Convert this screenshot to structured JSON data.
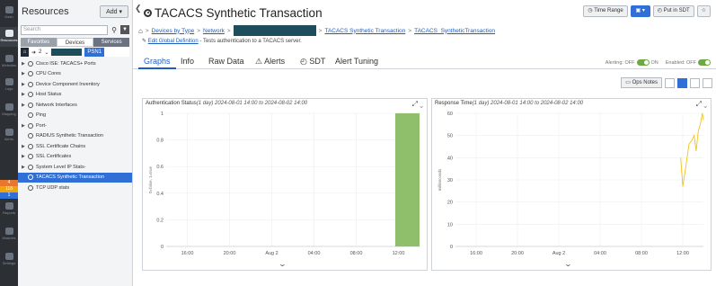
{
  "rail": {
    "items": [
      {
        "label": "Dash",
        "icon": "dashboard-icon"
      },
      {
        "label": "Resources",
        "icon": "resources-icon"
      },
      {
        "label": "Websites",
        "icon": "websites-icon"
      },
      {
        "label": "Logs",
        "icon": "logs-icon"
      },
      {
        "label": "Mapping",
        "icon": "mapping-icon"
      },
      {
        "label": "Alerts",
        "icon": "alerts-icon"
      },
      {
        "label": "Reports",
        "icon": "reports-icon"
      },
      {
        "label": "Modules",
        "icon": "modules-icon"
      },
      {
        "label": "Settings",
        "icon": "settings-icon"
      }
    ],
    "alert_counts": [
      {
        "value": "4",
        "color": "#e8762c"
      },
      {
        "value": "118",
        "color": "#f0a30a"
      },
      {
        "value": "1",
        "color": "#2f6fd6"
      }
    ]
  },
  "resources": {
    "title": "Resources",
    "add_label": "Add",
    "search_placeholder": "Search",
    "tabs": [
      "Favorites",
      "Devices",
      "Services"
    ],
    "path_count": "2",
    "path_suffix": "PSN1",
    "tree": [
      {
        "label": "Cisco ISE: TACACS+ Ports",
        "expand": true
      },
      {
        "label": "CPU Cores",
        "expand": true
      },
      {
        "label": "Device Component Inventory",
        "expand": true
      },
      {
        "label": "Host Status",
        "expand": true
      },
      {
        "label": "Network Interfaces",
        "expand": true
      },
      {
        "label": "Ping",
        "expand": false
      },
      {
        "label": "Port-",
        "expand": true
      },
      {
        "label": "RADIUS Synthetic Transaction",
        "expand": false
      },
      {
        "label": "SSL Certificate Chains",
        "expand": true
      },
      {
        "label": "SSL Certificates",
        "expand": true
      },
      {
        "label": "System Level IP Stats-",
        "expand": true
      },
      {
        "label": "TACACS Synthetic Transaction",
        "expand": false,
        "selected": true
      },
      {
        "label": "TCP UDP stats",
        "expand": false
      }
    ]
  },
  "header": {
    "title": "TACACS Synthetic Transaction",
    "time_range_label": "Time Range",
    "put_in_sdt_label": "Put in SDT",
    "star": "☆"
  },
  "breadcrumb": {
    "items": [
      "Devices by Type",
      "Network",
      "TACACS Synthetic Transaction",
      "TACACS_SyntheticTransaction"
    ]
  },
  "description": {
    "link": "Edit Global Definition",
    "text": " - Tests authentication to a TACACS server."
  },
  "tabs": [
    "Graphs",
    "Info",
    "Raw Data",
    "Alerts",
    "SDT",
    "Alert Tuning"
  ],
  "toggles": {
    "alerting_label": "Alerting:",
    "alerting_off": "OFF",
    "alerting_on": "ON",
    "enabled_label": "Enabled:",
    "enabled_off": "OFF"
  },
  "ops_notes_label": "Ops Notes",
  "chart_data": [
    {
      "type": "area",
      "title": "Authentication Status",
      "subtitle": "(1 day) 2024-08-01 14:00 to 2024-08-02 14:00",
      "ylabel": "0=false, 1=true",
      "ylim": [
        0,
        1
      ],
      "yticks": [
        "1",
        "0.8",
        "0.6",
        "0.4",
        "0.2",
        "0"
      ],
      "xticks": [
        "16:00",
        "20:00",
        "Aug 2",
        "04:00",
        "08:00",
        "12:00"
      ],
      "series": [
        {
          "color": "#8fbf6a",
          "x_start_hours": 21.7,
          "x_end_hours": 24,
          "value": 1
        }
      ]
    },
    {
      "type": "line",
      "title": "Response Time",
      "subtitle": "(1 day) 2024-08-01 14:00 to 2024-08-02 14:00",
      "ylabel": "milliseconds",
      "ylim": [
        0,
        60
      ],
      "yticks": [
        "60",
        "50",
        "40",
        "30",
        "20",
        "10",
        "0"
      ],
      "xticks": [
        "16:00",
        "20:00",
        "Aug 2",
        "04:00",
        "08:00",
        "12:00"
      ],
      "series": [
        {
          "color": "#f2c21b",
          "points": [
            [
              21.8,
              40
            ],
            [
              22.0,
              27
            ],
            [
              22.3,
              36
            ],
            [
              22.6,
              46
            ],
            [
              22.9,
              48
            ],
            [
              23.1,
              50
            ],
            [
              23.3,
              43
            ],
            [
              23.5,
              52
            ],
            [
              23.7,
              55
            ],
            [
              23.9,
              60
            ],
            [
              24,
              57
            ]
          ]
        }
      ]
    }
  ]
}
